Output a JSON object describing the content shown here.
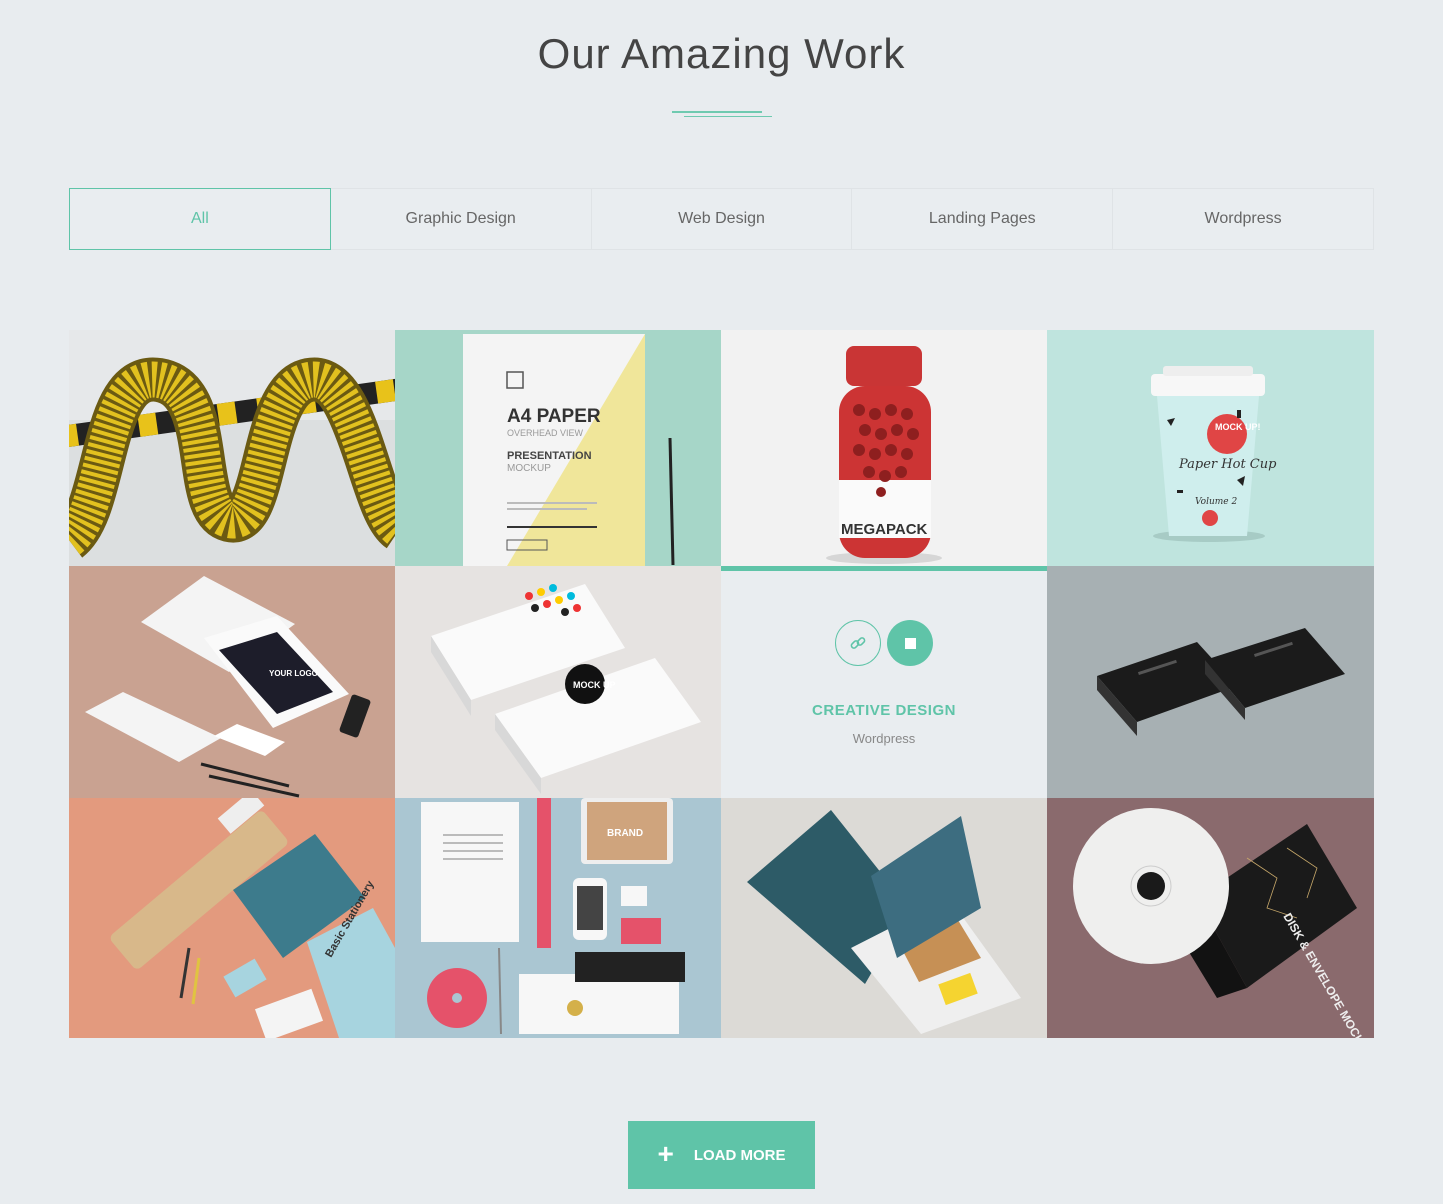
{
  "section": {
    "title": "Our Amazing Work"
  },
  "filters": [
    {
      "label": "All",
      "active": true
    },
    {
      "label": "Graphic Design",
      "active": false
    },
    {
      "label": "Web Design",
      "active": false
    },
    {
      "label": "Landing Pages",
      "active": false
    },
    {
      "label": "Wordpress",
      "active": false
    }
  ],
  "tiles": {
    "a4_paper": {
      "text1": "A4 PAPER",
      "text2": "OVERHEAD VIEW",
      "text3": "PRESENTATION",
      "text4": "MOCKUP"
    },
    "megapack": {
      "text": "MEGAPACK"
    },
    "cup": {
      "line1": "MOCK UP!",
      "line2": "Paper Hot Cup",
      "line3": "Volume 2"
    },
    "stationery": {
      "logo": "YOUR LOGO"
    },
    "cards": {
      "mock": "MOCK UP"
    },
    "hover_item": {
      "title": "CREATIVE DESIGN",
      "category": "Wordpress",
      "link_icon": "link-icon",
      "expand_icon": "stop-square-icon"
    },
    "basic": {
      "text": "Basic Stationery"
    },
    "brand": {
      "text": "BRAND"
    },
    "disk": {
      "text": "DISK & ENVELOPE MOCKUP"
    }
  },
  "load_more": {
    "label": "LOAD MORE",
    "icon": "plus-icon"
  },
  "colors": {
    "accent": "#5fc4a8",
    "background": "#e8ecef"
  }
}
